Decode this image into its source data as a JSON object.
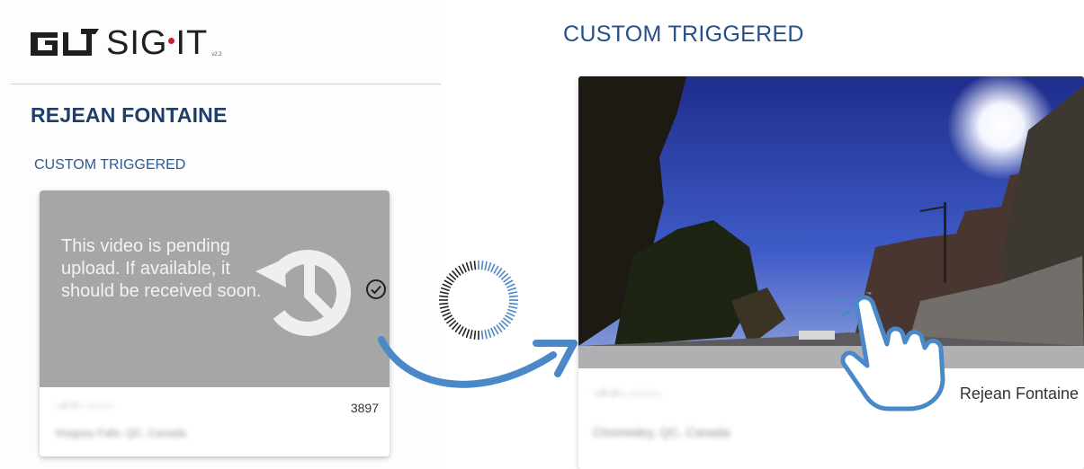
{
  "logo": {
    "text_pre": "SIG",
    "text_post": "IT",
    "version": "v2.2"
  },
  "left": {
    "driver_name": "REJEAN FONTAINE",
    "event_type": "CUSTOM TRIGGERED",
    "pending_message": "This video is pending upload. If available, it should be received soon.",
    "card": {
      "timestamp_blurred": "--/--/-- --:--:--",
      "count": "3897",
      "location_blurred": "Kingsey Falls, QC, Canada"
    }
  },
  "right": {
    "event_type": "CUSTOM TRIGGERED",
    "card": {
      "timestamp_blurred": "--/--/-- --:--:--",
      "location_blurred": "Chomedey, QC, Canada",
      "driver": "Rejean Fontaine"
    }
  },
  "colors": {
    "brand_blue": "#1f3f6a",
    "accent_blue": "#4a88c7",
    "pending_gray": "#a6a6a6",
    "logo_red": "#d0202e"
  },
  "icons": [
    "history-icon",
    "check-circle-icon",
    "loading-spinner",
    "curved-arrow",
    "star-icon",
    "pointing-hand-icon"
  ]
}
